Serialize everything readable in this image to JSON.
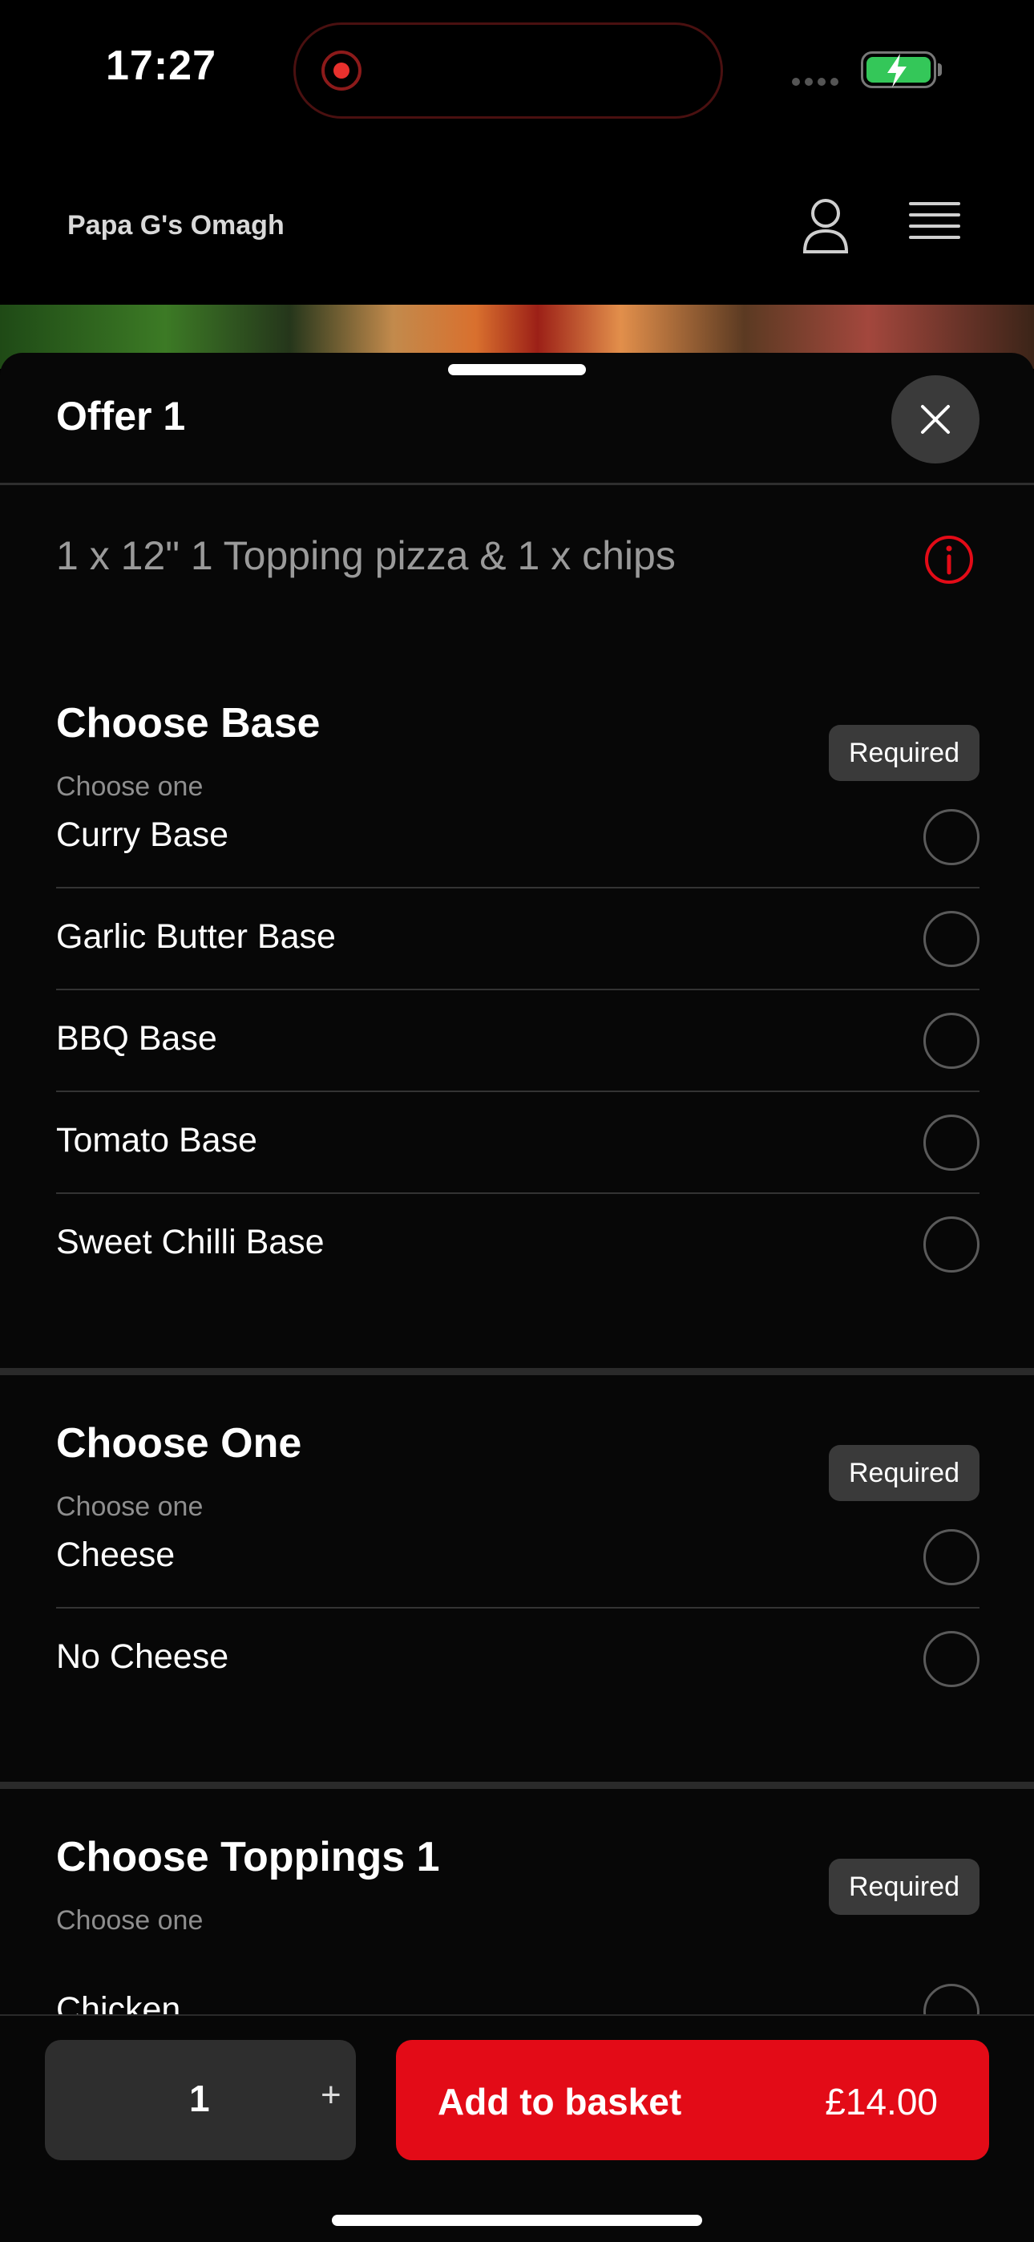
{
  "status_bar": {
    "time": "17:27"
  },
  "header": {
    "brand": "Papa G's Omagh"
  },
  "sheet": {
    "title": "Offer 1",
    "description": "1 x 12\" 1 Topping pizza & 1 x chips"
  },
  "groups": [
    {
      "title": "Choose Base",
      "subtitle": "Choose one",
      "badge": "Required",
      "options": [
        "Curry Base",
        "Garlic Butter Base",
        "BBQ Base",
        "Tomato Base",
        "Sweet Chilli Base"
      ]
    },
    {
      "title": "Choose One",
      "subtitle": "Choose one",
      "badge": "Required",
      "options": [
        "Cheese",
        "No Cheese"
      ]
    },
    {
      "title": "Choose Toppings 1",
      "subtitle": "Choose one",
      "badge": "Required",
      "options": [
        "Chicken"
      ]
    }
  ],
  "footer": {
    "quantity": "1",
    "plus": "+",
    "add_label": "Add to basket",
    "price": "£14.00"
  },
  "colors": {
    "accent": "#e30b17",
    "background": "#070707",
    "battery": "#34c759"
  },
  "icons": [
    "record-icon",
    "battery-icon",
    "user-icon",
    "menu-icon",
    "close-icon",
    "info-icon"
  ]
}
